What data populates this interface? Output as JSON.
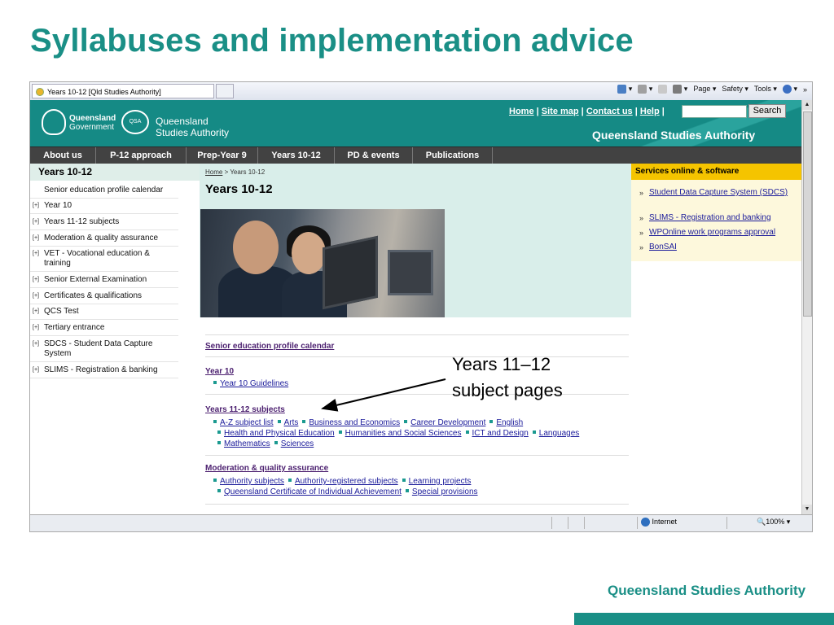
{
  "slide": {
    "title": "Syllabuses and implementation advice",
    "callout": [
      "Years 11–12",
      "subject pages"
    ],
    "footer": "Queensland Studies Authority"
  },
  "browser": {
    "tab_title": "Years 10-12 [Qld Studies Authority]",
    "commands": [
      "Page ▾",
      "Safety ▾",
      "Tools ▾"
    ],
    "status_zone": "Internet",
    "zoom": "100%"
  },
  "site": {
    "logo_qg": [
      "Queensland",
      "Government"
    ],
    "logo_qsa": [
      "Queensland",
      "Studies Authority"
    ],
    "logo_qsa_badge": "QSA",
    "toplinks": [
      "Home",
      "Site map",
      "Contact us",
      "Help"
    ],
    "search_button": "Search",
    "header_title": "Queensland Studies Authority",
    "nav": [
      "About us",
      "P-12 approach",
      "Prep-Year 9",
      "Years 10-12",
      "PD & events",
      "Publications"
    ]
  },
  "left": {
    "heading": "Years 10-12",
    "items": [
      "Senior education profile calendar",
      "Year 10",
      "Years 11-12 subjects",
      "Moderation & quality assurance",
      "VET - Vocational education & training",
      "Senior External Examination",
      "Certificates & qualifications",
      "QCS Test",
      "Tertiary entrance",
      "SDCS - Student Data Capture System",
      "SLIMS - Registration & banking"
    ],
    "expander": "[+]"
  },
  "main": {
    "breadcrumb_home": "Home",
    "breadcrumb_current": "Years 10-12",
    "heading": "Years 10-12",
    "sections": {
      "sepc": "Senior education profile calendar",
      "year10": "Year 10",
      "year10_links": [
        "Year 10 Guidelines"
      ],
      "y1112": "Years 11-12 subjects",
      "y1112_links_1": [
        "A-Z subject list",
        "Arts",
        "Business and Economics",
        "Career Development",
        "English"
      ],
      "y1112_links_2": [
        "Health and Physical Education",
        "Humanities and Social Sciences",
        "ICT and Design",
        "Languages"
      ],
      "y1112_links_3": [
        "Mathematics",
        "Sciences"
      ],
      "moderation": "Moderation & quality assurance",
      "mod_links_1": [
        "Authority subjects",
        "Authority-registered subjects",
        "Learning projects"
      ],
      "mod_links_2": [
        "Queensland Certificate of Individual Achievement",
        "Special provisions"
      ]
    }
  },
  "right": {
    "heading": "Services online & software",
    "items": [
      "Student Data Capture System (SDCS)",
      "SLIMS - Registration and banking",
      "WPOnline work programs approval",
      "BonSAI"
    ]
  },
  "colors": {
    "teal": "#1a8f86",
    "nav": "#424242",
    "services": "#f5c400"
  }
}
